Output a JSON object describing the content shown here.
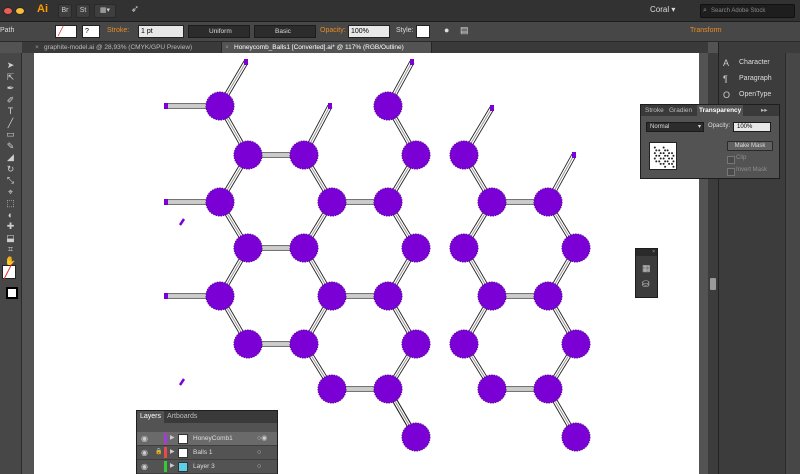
{
  "app": {
    "logo": "Ai",
    "bridge": "Br",
    "stock": "St",
    "workspace": "Coral",
    "search_placeholder": "Search Adobe Stock"
  },
  "control_bar": {
    "selection_label": "Path",
    "stroke_label": "Stroke:",
    "stroke_weight": "1 pt",
    "profile": "Uniform",
    "brush": "Basic",
    "opacity_label": "Opacity:",
    "opacity_value": "100%",
    "style_label": "Style:",
    "transform_label": "Transform"
  },
  "tabs": [
    {
      "label": "graphite-model.ai @ 28,93% (CMYK/GPU Preview)",
      "active": false
    },
    {
      "label": "Honeycomb_Balls1 [Converted].ai* @ 117% (RGB/Outline)",
      "active": true
    }
  ],
  "dock": {
    "items": [
      {
        "label": "Character",
        "icon": "A"
      },
      {
        "label": "Paragraph",
        "icon": "¶"
      },
      {
        "label": "OpenType",
        "icon": "O"
      }
    ]
  },
  "transparency_panel": {
    "tabs": [
      "Stroke",
      "Gradien",
      "Transparency"
    ],
    "active_tab": "Transparency",
    "blend_mode": "Normal",
    "opacity_label": "Opacity:",
    "opacity_value": "100%",
    "make_mask": "Make Mask",
    "clip": "Clip",
    "invert_mask": "Invert Mask"
  },
  "layers_panel": {
    "tabs": [
      "Layers",
      "Artboards"
    ],
    "active_tab": "Layers",
    "layers": [
      {
        "name": "HoneyComb1",
        "color": "#a53bd8",
        "locked": false,
        "selected": true
      },
      {
        "name": "Balls 1",
        "color": "#e84a4a",
        "locked": true,
        "selected": false
      },
      {
        "name": "Layer 3",
        "color": "#33cc33",
        "locked": false,
        "selected": false
      }
    ]
  },
  "colors": {
    "ball": "#7b00d6",
    "app_bg": "#535353",
    "accent": "#e98c22"
  }
}
